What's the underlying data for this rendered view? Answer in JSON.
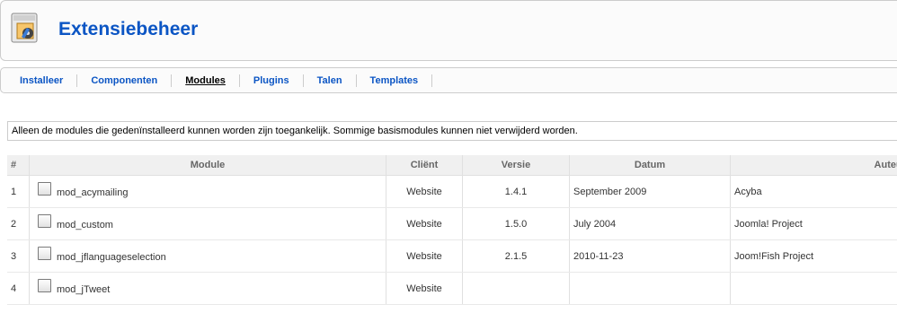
{
  "header": {
    "title": "Extensiebeheer",
    "icon": "extension-manager-icon"
  },
  "submenu": {
    "items": [
      {
        "label": "Installeer",
        "active": false
      },
      {
        "label": "Componenten",
        "active": false
      },
      {
        "label": "Modules",
        "active": true
      },
      {
        "label": "Plugins",
        "active": false
      },
      {
        "label": "Talen",
        "active": false
      },
      {
        "label": "Templates",
        "active": false
      }
    ]
  },
  "notice": "Alleen de modules die gedenïnstalleerd kunnen worden zijn toegankelijk. Sommige basismodules kunnen niet verwijderd worden.",
  "table": {
    "columns": [
      "#",
      "Module",
      "Cliënt",
      "Versie",
      "Datum",
      "Auteur"
    ],
    "rows": [
      {
        "num": "1",
        "module": "mod_acymailing",
        "client": "Website",
        "version": "1.4.1",
        "date": "September 2009",
        "author": "Acyba"
      },
      {
        "num": "2",
        "module": "mod_custom",
        "client": "Website",
        "version": "1.5.0",
        "date": "July 2004",
        "author": "Joomla! Project"
      },
      {
        "num": "3",
        "module": "mod_jflanguageselection",
        "client": "Website",
        "version": "2.1.5",
        "date": "2010-11-23",
        "author": "Joom!Fish Project"
      },
      {
        "num": "4",
        "module": "mod_jTweet",
        "client": "Website",
        "version": "",
        "date": "",
        "author": ""
      }
    ]
  }
}
